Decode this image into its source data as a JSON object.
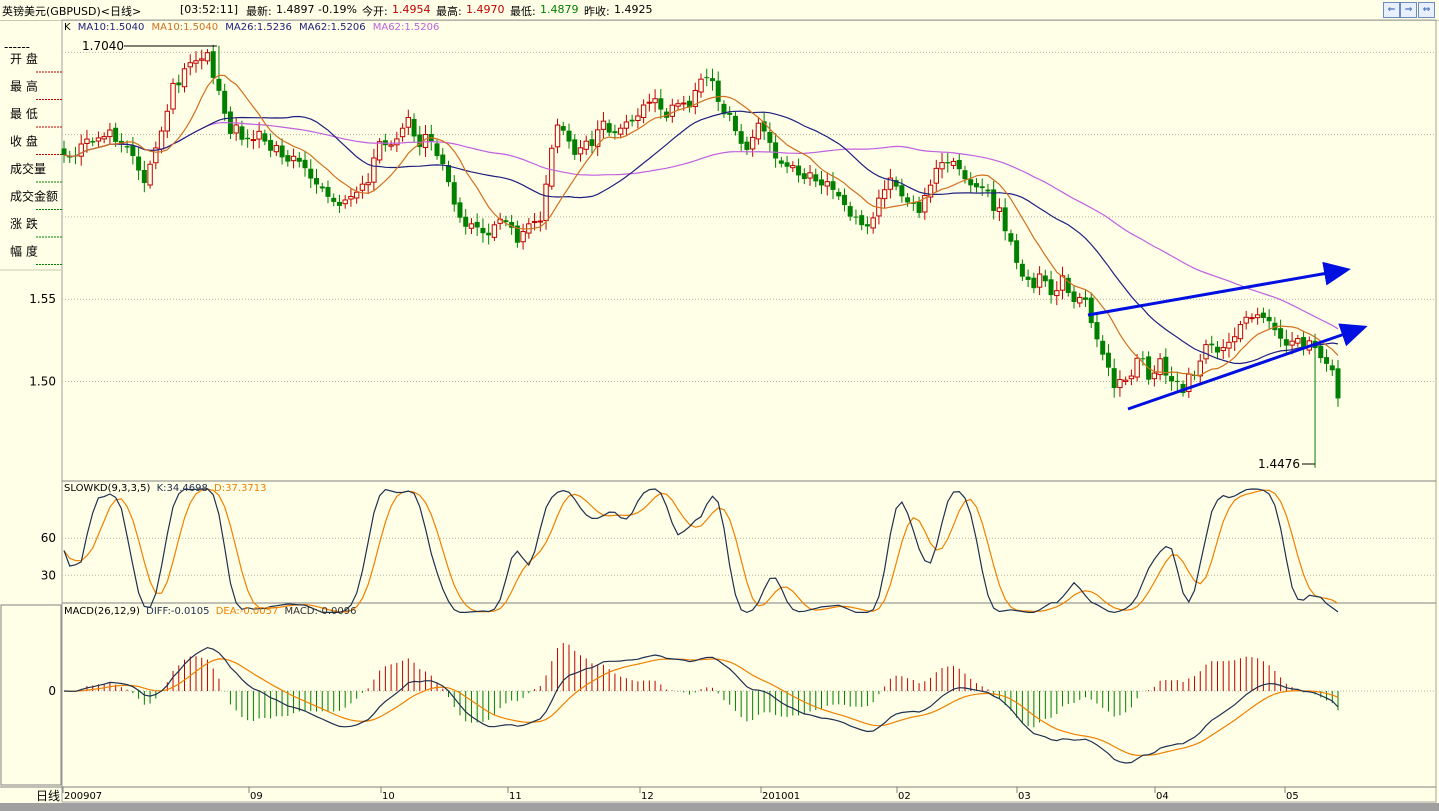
{
  "header": {
    "title": "英镑美元(GBPUSD)<日线>",
    "time": "[03:52:11]",
    "latest_label": "最新:",
    "latest_value": "1.4897",
    "change": "-0.19%",
    "open_label": "今开:",
    "open_value": "1.4954",
    "high_label": "最高:",
    "high_value": "1.4970",
    "low_label": "最低:",
    "low_value": "1.4879",
    "prev_label": "昨收:",
    "prev_value": "1.4925"
  },
  "left_panel": {
    "dashes": "------",
    "items": [
      "开  盘",
      "最  高",
      "最  低",
      "收  盘",
      "成交量",
      "成交金额",
      "涨  跌",
      "幅  度"
    ]
  },
  "main_panel": {
    "ma_header": {
      "k_label": "K",
      "ma10_a": "MA10:1.5040",
      "ma10_b": "MA10:1.5040",
      "ma26": "MA26:1.5236",
      "ma62_a": "MA62:1.5206",
      "ma62_b": "MA62:1.5206"
    },
    "y_ticks": [
      "1.55",
      "1.50"
    ],
    "high_marker": "1.7040",
    "low_marker": "1.4476"
  },
  "kd_panel": {
    "header_name": "SLOWKD(9,3,3,5)",
    "k_text": "K:34.4698",
    "d_text": "D:37.3713",
    "y_ticks": [
      "60",
      "30"
    ]
  },
  "macd_panel": {
    "header_name": "MACD(26,12,9)",
    "diff_text": "DIFF:-0.0105",
    "dea_text": "DEA:-0.0057",
    "macd_text": "MACD:-0.0096",
    "y_ticks": [
      "0"
    ]
  },
  "x_axis": {
    "corner_label": "日线",
    "labels": [
      "200907",
      "09",
      "10",
      "11",
      "12",
      "201001",
      "02",
      "03",
      "04",
      "05"
    ]
  },
  "colors": {
    "up": "#C00000",
    "down": "#008000",
    "ma10": "#D07020",
    "ma26": "#202080",
    "ma62": "#C060E0",
    "trend": "#0010E0",
    "kd_k": "#203050",
    "kd_d": "#F08000"
  },
  "chart_data": {
    "type": "candlestick",
    "instrument": "GBPUSD",
    "period": "daily",
    "date_range": [
      "200907",
      "201005"
    ],
    "price_range": [
      1.4476,
      1.704
    ],
    "last": {
      "open": 1.4954,
      "high": 1.497,
      "low": 1.4879,
      "close": 1.4897,
      "prev_close": 1.4925
    },
    "moving_averages": {
      "MA10": 1.504,
      "MA26": 1.5236,
      "MA62": 1.5206
    },
    "close_series": [
      1.6376,
      1.6362,
      1.6372,
      1.6443,
      1.6473,
      1.6452,
      1.648,
      1.6488,
      1.6528,
      1.6456,
      1.6439,
      1.6422,
      1.637,
      1.6282,
      1.6206,
      1.632,
      1.6419,
      1.6522,
      1.6642,
      1.6811,
      1.68,
      1.69,
      1.6937,
      1.6949,
      1.696,
      1.6998,
      1.6845,
      1.6766,
      1.6627,
      1.6504,
      1.6559,
      1.6469,
      1.6472,
      1.647,
      1.652,
      1.6458,
      1.6402,
      1.6434,
      1.6362,
      1.6336,
      1.6368,
      1.6335,
      1.6296,
      1.6233,
      1.6197,
      1.6173,
      1.6122,
      1.6091,
      1.6067,
      1.6103,
      1.6124,
      1.615,
      1.6199,
      1.6208,
      1.6358,
      1.6457,
      1.6436,
      1.6438,
      1.6474,
      1.6539,
      1.6604,
      1.6489,
      1.6425,
      1.6501,
      1.6459,
      1.637,
      1.6321,
      1.6211,
      1.6075,
      1.5995,
      1.594,
      1.5958,
      1.5936,
      1.5901,
      1.5888,
      1.5952,
      1.5986,
      1.5969,
      1.5934,
      1.5843,
      1.5911,
      1.5958,
      1.5972,
      1.5975,
      1.6199,
      1.6417,
      1.6558,
      1.6524,
      1.6458,
      1.6377,
      1.642,
      1.646,
      1.6431,
      1.6529,
      1.6582,
      1.6512,
      1.6509,
      1.6539,
      1.6577,
      1.658,
      1.6613,
      1.668,
      1.6697,
      1.6718,
      1.6652,
      1.6602,
      1.6679,
      1.6688,
      1.6692,
      1.6665,
      1.6768,
      1.6837,
      1.6846,
      1.6825,
      1.6699,
      1.6624,
      1.662,
      1.6521,
      1.6444,
      1.6407,
      1.6483,
      1.6569,
      1.6519,
      1.645,
      1.6355,
      1.6323,
      1.6305,
      1.6312,
      1.6252,
      1.623,
      1.6268,
      1.6216,
      1.6191,
      1.6214,
      1.6164,
      1.6125,
      1.6072,
      1.6002,
      1.5997,
      1.595,
      1.5942,
      1.5994,
      1.6114,
      1.6165,
      1.6236,
      1.6184,
      1.6125,
      1.6088,
      1.6079,
      1.6024,
      1.613,
      1.6193,
      1.6295,
      1.633,
      1.6325,
      1.6337,
      1.629,
      1.6229,
      1.6192,
      1.618,
      1.6175,
      1.6155,
      1.6036,
      1.6055,
      1.5913,
      1.5849,
      1.5721,
      1.5637,
      1.5617,
      1.5567,
      1.5653,
      1.5609,
      1.5525,
      1.5552,
      1.5642,
      1.5538,
      1.5483,
      1.5511,
      1.5496,
      1.5355,
      1.5256,
      1.5163,
      1.5084,
      1.496,
      1.5012,
      1.5008,
      1.5033,
      1.5141,
      1.5139,
      1.5011,
      1.5051,
      1.5138,
      1.5036,
      1.5001,
      1.4997,
      1.493,
      1.5045,
      1.5034,
      1.5124,
      1.5224,
      1.522,
      1.5176,
      1.5206,
      1.5238,
      1.5272,
      1.5346,
      1.539,
      1.5388,
      1.5405,
      1.5386,
      1.5366,
      1.5312,
      1.526,
      1.5218,
      1.5245,
      1.5261,
      1.5197,
      1.5247,
      1.5203,
      1.5142,
      1.5107,
      1.5068,
      1.4897
    ]
  }
}
